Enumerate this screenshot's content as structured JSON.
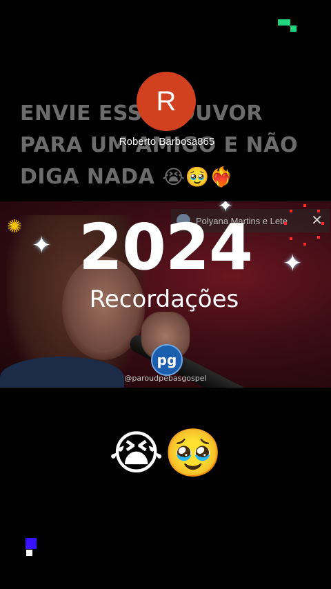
{
  "headline": {
    "line1": "ENVIE ESSE LOUVOR",
    "line2": "PARA UM AMIGO E NÃO",
    "line3": "DIGA NADA",
    "line3_emojis": "😭🥹❤️‍🔥"
  },
  "author": {
    "initial": "R",
    "name": "Roberto Barbosa865",
    "avatar_color": "#d1401f"
  },
  "video": {
    "year": "2024",
    "subtitle": "Recordações",
    "logo_text": "pg",
    "handle": "@paroudpebasgospel",
    "banner_name": "Polyana Martins e Lete",
    "close_glyph": "✕"
  },
  "reaction_emojis": "😭🥹",
  "icons": {
    "gear": "gear-icon",
    "sparkle": "sparkle-icon",
    "close": "close-icon"
  },
  "colors": {
    "background": "#000000",
    "headline": "#6c6c6c",
    "accent_green": "#1fd67f",
    "accent_blue": "#3a12ff"
  }
}
